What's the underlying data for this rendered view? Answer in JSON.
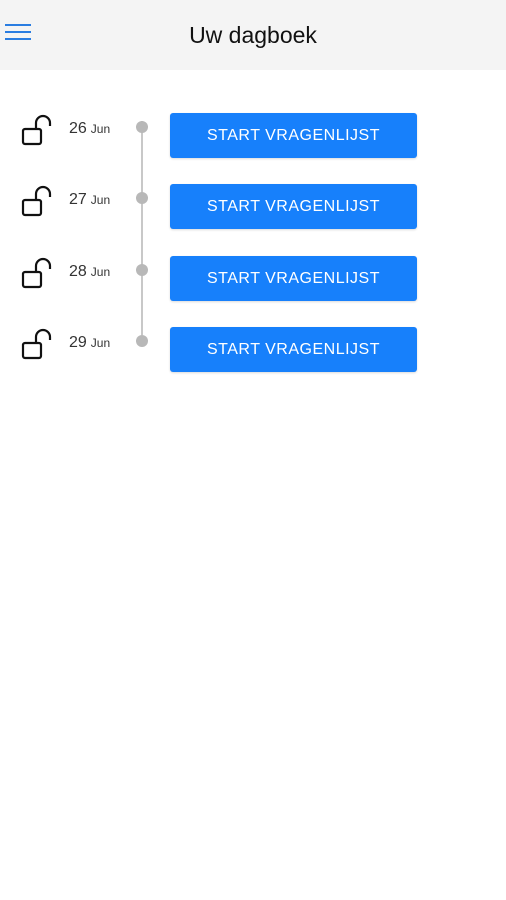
{
  "header": {
    "title": "Uw dagboek",
    "menu_icon": "hamburger-menu-icon",
    "menu_color": "#2a7de1",
    "background": "#f4f4f4"
  },
  "entries": [
    {
      "day": "26",
      "month": "Jun",
      "button_label": "START VRAGENLIJST",
      "lock_icon": "unlocked-padlock-icon"
    },
    {
      "day": "27",
      "month": "Jun",
      "button_label": "START VRAGENLIJST",
      "lock_icon": "unlocked-padlock-icon"
    },
    {
      "day": "28",
      "month": "Jun",
      "button_label": "START VRAGENLIJST",
      "lock_icon": "unlocked-padlock-icon"
    },
    {
      "day": "29",
      "month": "Jun",
      "button_label": "START VRAGENLIJST",
      "lock_icon": "unlocked-padlock-icon"
    }
  ],
  "colors": {
    "button": "#1780fb",
    "button_text": "#ffffff",
    "timeline": "#c8c8c8"
  }
}
